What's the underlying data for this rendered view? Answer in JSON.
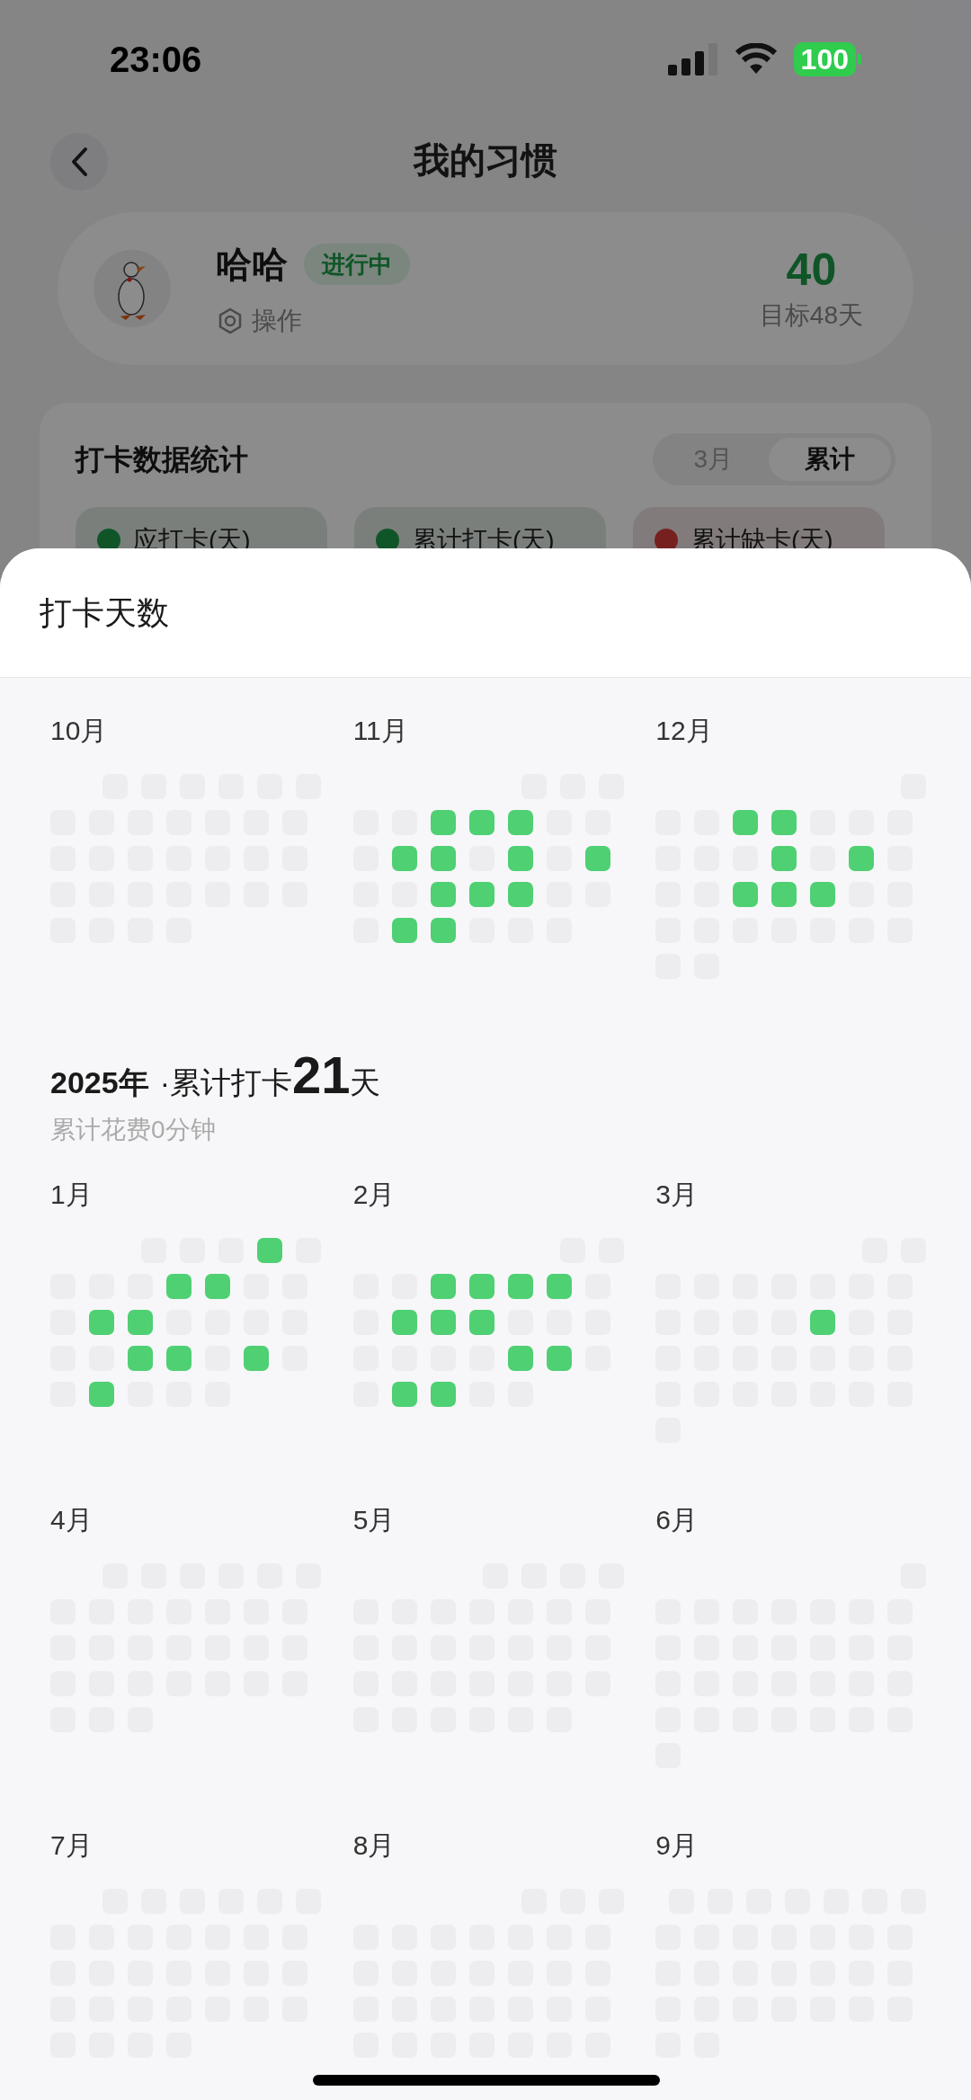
{
  "status_bar": {
    "time": "23:06",
    "battery": "100"
  },
  "header": {
    "title": "我的习惯"
  },
  "habit": {
    "name": "哈哈",
    "status": "进行中",
    "action": "操作",
    "count": "40",
    "goal": "目标48天"
  },
  "stats": {
    "title": "打卡数据统计",
    "tabs": [
      {
        "label": "3月",
        "selected": false
      },
      {
        "label": "累计",
        "selected": true
      }
    ],
    "chips": [
      {
        "label": "应打卡(天)",
        "color": "#105528"
      },
      {
        "label": "累计打卡(天)",
        "color": "#105528"
      },
      {
        "label": "累计缺卡(天)",
        "color": "#772020"
      }
    ]
  },
  "sheet": {
    "title": "打卡天数",
    "sections": [
      {
        "months": [
          {
            "label": "10月",
            "weeks": [
              [
                false,
                false,
                false,
                false,
                false,
                false
              ],
              [
                false,
                false,
                false,
                false,
                false,
                false,
                false
              ],
              [
                false,
                false,
                false,
                false,
                false,
                false,
                false
              ],
              [
                false,
                false,
                false,
                false,
                false,
                false,
                false
              ],
              [
                false,
                false,
                false,
                false
              ]
            ]
          },
          {
            "label": "11月",
            "weeks": [
              [
                false,
                false,
                false
              ],
              [
                false,
                false,
                true,
                true,
                true,
                false,
                false
              ],
              [
                false,
                true,
                true,
                false,
                true,
                false,
                true
              ],
              [
                false,
                false,
                true,
                true,
                true,
                false,
                false
              ],
              [
                false,
                true,
                true,
                false,
                false,
                false
              ]
            ]
          },
          {
            "label": "12月",
            "weeks": [
              [
                false
              ],
              [
                false,
                false,
                true,
                true,
                false,
                false,
                false
              ],
              [
                false,
                false,
                false,
                true,
                false,
                true,
                false
              ],
              [
                false,
                false,
                true,
                true,
                true,
                false,
                false
              ],
              [
                false,
                false,
                false,
                false,
                false,
                false,
                false
              ],
              [
                false,
                false
              ]
            ]
          }
        ]
      },
      {
        "year": "2025年",
        "summary_label": "·累计打卡",
        "summary_count": "21",
        "summary_unit": "天",
        "subtitle": "累计花费0分钟",
        "months": [
          {
            "label": "1月",
            "weeks": [
              [
                false,
                false,
                false,
                true,
                false
              ],
              [
                false,
                false,
                false,
                true,
                true,
                false,
                false
              ],
              [
                false,
                true,
                true,
                false,
                false,
                false,
                false
              ],
              [
                false,
                false,
                true,
                true,
                false,
                true,
                false
              ],
              [
                false,
                true,
                false,
                false,
                false
              ]
            ]
          },
          {
            "label": "2月",
            "weeks": [
              [
                false,
                false
              ],
              [
                false,
                false,
                true,
                true,
                true,
                true,
                false
              ],
              [
                false,
                true,
                true,
                true,
                false,
                false,
                false
              ],
              [
                false,
                false,
                false,
                false,
                true,
                true,
                false
              ],
              [
                false,
                true,
                true,
                false,
                false
              ]
            ]
          },
          {
            "label": "3月",
            "weeks": [
              [
                false,
                false
              ],
              [
                false,
                false,
                false,
                false,
                false,
                false,
                false
              ],
              [
                false,
                false,
                false,
                false,
                true,
                false,
                false
              ],
              [
                false,
                false,
                false,
                false,
                false,
                false,
                false
              ],
              [
                false,
                false,
                false,
                false,
                false,
                false,
                false
              ],
              [
                false
              ]
            ]
          },
          {
            "label": "4月",
            "weeks": [
              [
                false,
                false,
                false,
                false,
                false,
                false
              ],
              [
                false,
                false,
                false,
                false,
                false,
                false,
                false
              ],
              [
                false,
                false,
                false,
                false,
                false,
                false,
                false
              ],
              [
                false,
                false,
                false,
                false,
                false,
                false,
                false
              ],
              [
                false,
                false,
                false
              ]
            ]
          },
          {
            "label": "5月",
            "weeks": [
              [
                false,
                false,
                false,
                false
              ],
              [
                false,
                false,
                false,
                false,
                false,
                false,
                false
              ],
              [
                false,
                false,
                false,
                false,
                false,
                false,
                false
              ],
              [
                false,
                false,
                false,
                false,
                false,
                false,
                false
              ],
              [
                false,
                false,
                false,
                false,
                false,
                false
              ]
            ]
          },
          {
            "label": "6月",
            "weeks": [
              [
                false
              ],
              [
                false,
                false,
                false,
                false,
                false,
                false,
                false
              ],
              [
                false,
                false,
                false,
                false,
                false,
                false,
                false
              ],
              [
                false,
                false,
                false,
                false,
                false,
                false,
                false
              ],
              [
                false,
                false,
                false,
                false,
                false,
                false,
                false
              ],
              [
                false
              ]
            ]
          },
          {
            "label": "7月",
            "weeks": [
              [
                false,
                false,
                false,
                false,
                false,
                false
              ],
              [
                false,
                false,
                false,
                false,
                false,
                false,
                false
              ],
              [
                false,
                false,
                false,
                false,
                false,
                false,
                false
              ],
              [
                false,
                false,
                false,
                false,
                false,
                false,
                false
              ],
              [
                false,
                false,
                false,
                false
              ]
            ]
          },
          {
            "label": "8月",
            "weeks": [
              [
                false,
                false,
                false
              ],
              [
                false,
                false,
                false,
                false,
                false,
                false,
                false
              ],
              [
                false,
                false,
                false,
                false,
                false,
                false,
                false
              ],
              [
                false,
                false,
                false,
                false,
                false,
                false,
                false
              ],
              [
                false,
                false,
                false,
                false,
                false,
                false,
                false
              ]
            ]
          },
          {
            "label": "9月",
            "weeks": [
              [
                false,
                false,
                false,
                false,
                false,
                false,
                false
              ],
              [
                false,
                false,
                false,
                false,
                false,
                false,
                false
              ],
              [
                false,
                false,
                false,
                false,
                false,
                false,
                false
              ],
              [
                false,
                false,
                false,
                false,
                false,
                false,
                false
              ],
              [
                false,
                false
              ]
            ]
          }
        ]
      }
    ]
  }
}
